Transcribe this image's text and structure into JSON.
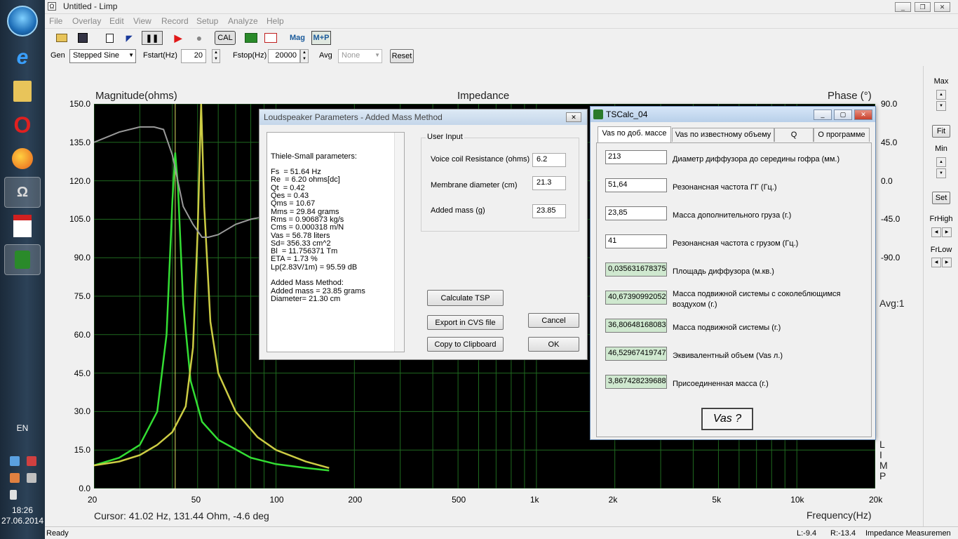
{
  "taskbar": {
    "lang": "EN",
    "time": "18:26",
    "date": "27.06.2014"
  },
  "window": {
    "title": "Untitled - Limp"
  },
  "menu": [
    "File",
    "Overlay",
    "Edit",
    "View",
    "Record",
    "Setup",
    "Analyze",
    "Help"
  ],
  "toolbar": {
    "cal": "CAL",
    "mag": "Mag",
    "mp": "M+P"
  },
  "gen": {
    "gen_label": "Gen",
    "gen_value": "Stepped Sine",
    "fstart_label": "Fstart(Hz)",
    "fstart": "20",
    "fstop_label": "Fstop(Hz)",
    "fstop": "20000",
    "avg_label": "Avg",
    "avg": "None",
    "reset": "Reset"
  },
  "chart_data": {
    "type": "line",
    "title": "Impedance",
    "ylabel_left": "Magnitude(ohms)",
    "ylabel_right": "Phase (°)",
    "xlabel": "Frequency(Hz)",
    "x_scale": "log",
    "xlim": [
      20,
      20000
    ],
    "ylim": [
      0,
      150
    ],
    "ylim_right": [
      -90,
      90
    ],
    "x_ticks": [
      "20",
      "50",
      "100",
      "200",
      "500",
      "1k",
      "2k",
      "5k",
      "10k",
      "20k"
    ],
    "y_ticks": [
      "150.0",
      "135.0",
      "120.0",
      "105.0",
      "90.0",
      "75.0",
      "60.0",
      "45.0",
      "30.0",
      "15.0",
      "0.0"
    ],
    "y_ticks_right": [
      "90.0",
      "45.0",
      "0.0",
      "-45.0",
      "-90.0"
    ],
    "grid": true,
    "series": [
      {
        "color": "#33dd33",
        "x": [
          20,
          25,
          30,
          35,
          38,
          40,
          41,
          42,
          44,
          47,
          52,
          60,
          80,
          100,
          130,
          160
        ],
        "y": [
          9,
          12,
          17,
          30,
          60,
          112,
          131,
          118,
          72,
          42,
          26,
          19,
          12,
          9.5,
          8,
          7
        ]
      },
      {
        "color": "#cccc44",
        "x": [
          20,
          25,
          30,
          35,
          40,
          45,
          48,
          50,
          51.6,
          53,
          56,
          60,
          70,
          85,
          100,
          130,
          160
        ],
        "y": [
          9,
          10.5,
          13,
          17,
          22,
          32,
          55,
          100,
          150,
          110,
          65,
          45,
          30,
          20,
          15,
          10.5,
          8
        ]
      },
      {
        "color": "#9a9a9a",
        "x": [
          20,
          25,
          30,
          34,
          37,
          40,
          44,
          48,
          52,
          55,
          60,
          70,
          80,
          90,
          100
        ],
        "y": [
          135,
          139,
          141,
          141,
          140,
          130,
          110,
          103,
          98,
          98,
          99,
          103,
          105,
          106,
          107
        ]
      }
    ],
    "cursor_x": 41.02
  },
  "graph": {
    "cursor_text": "Cursor: 41.02 Hz, 131.44 Ohm, -4.6 deg",
    "avg_text": "Avg:1",
    "limp_vertical": [
      "L",
      "I",
      "M",
      "P"
    ]
  },
  "right_panel": {
    "max": "Max",
    "fit": "Fit",
    "min": "Min",
    "set": "Set",
    "frhigh": "FrHigh",
    "frlow": "FrLow"
  },
  "status": {
    "left": "Ready",
    "l": "L:-9.4",
    "r": "R:-13.4",
    "mode": "Impedance Measuremen"
  },
  "added_mass_dialog": {
    "title": "Loudspeaker Parameters - Added Mass Method",
    "tsp_text": "Thiele-Small parameters:\n\nFs  = 51.64 Hz\nRe  = 6.20 ohms[dc]\nQt  = 0.42\nQes = 0.43\nQms = 10.67\nMms = 29.84 grams\nRms = 0.906873 kg/s\nCms = 0.000318 m/N\nVas = 56.78 liters\nSd= 356.33 cm^2\nBl  = 11.756371 Tm\nETA = 1.73 %\nLp(2.83V/1m) = 95.59 dB\n\nAdded Mass Method:\nAdded mass = 23.85 grams\nDiameter= 21.30 cm",
    "group": "User Input",
    "vc_label": "Voice coil Resistance (ohms)",
    "vc": "6.2",
    "md_label": "Membrane diameter (cm)",
    "md": "21.3",
    "am_label": "Added mass (g)",
    "am": "23.85",
    "calc": "Calculate TSP",
    "export": "Export in CVS file",
    "copy": "Copy to Clipboard",
    "cancel": "Cancel",
    "ok": "OK"
  },
  "tscalc": {
    "title": "TSCalc_04",
    "tabs": [
      "Vas по доб. массе",
      "Vas по известному объему",
      "Q",
      "О программе"
    ],
    "rows": [
      {
        "value": "213",
        "label": "Диаметр диффузора до середины гофра (мм.)",
        "out": false
      },
      {
        "value": "51,64",
        "label": "Резонансная частота ГГ (Гц.)",
        "out": false
      },
      {
        "value": "23,85",
        "label": "Масса дополнительного груза (г.)",
        "out": false
      },
      {
        "value": "41",
        "label": "Резонансная частота с грузом (Гц.)",
        "out": false
      },
      {
        "value": "0,035631678375",
        "label": "Площадь диффузора (м.кв.)",
        "out": true
      },
      {
        "value": "40,67390992052",
        "label": "Масса подвижной системы с соколеблющимся воздухом (г.)",
        "out": true
      },
      {
        "value": "36,80648168083",
        "label": "Масса подвижной системы (г.)",
        "out": true
      },
      {
        "value": "46,52967419747",
        "label": "Эквивалентный объем (Vas л.)",
        "out": true
      },
      {
        "value": "3,867428239688",
        "label": "Присоединенная масса (г.)",
        "out": true
      }
    ],
    "button": "Vas ?"
  }
}
